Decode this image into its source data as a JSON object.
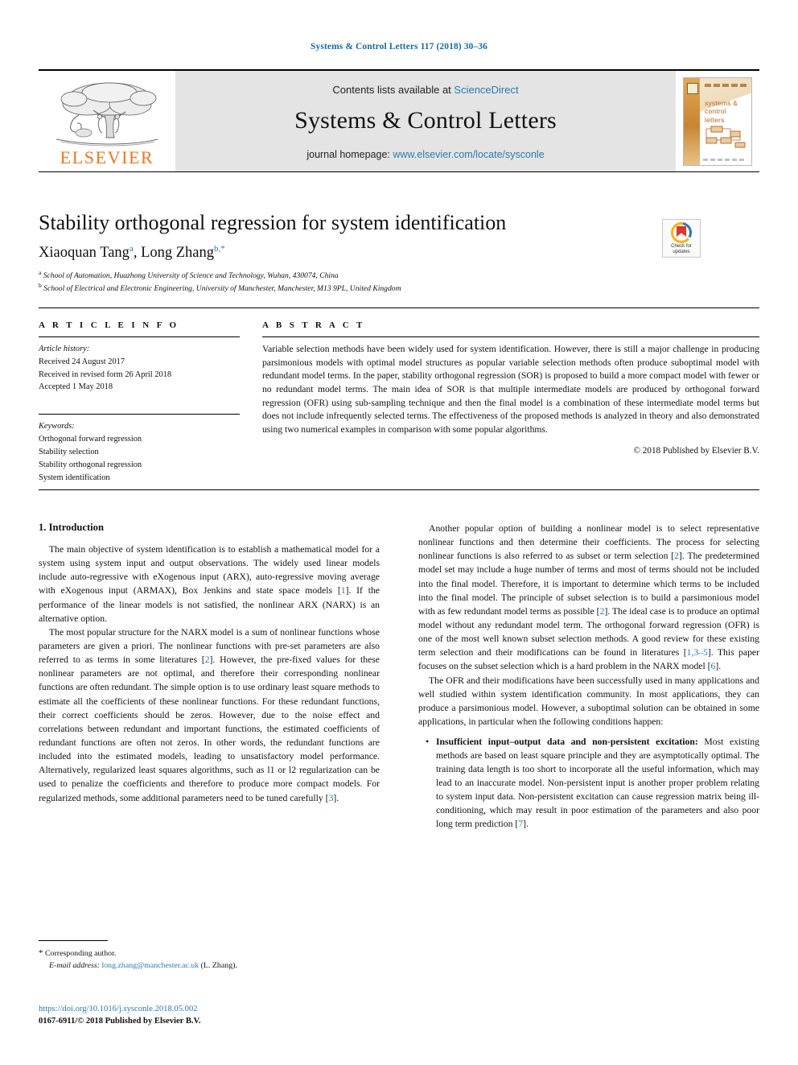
{
  "running_head": "Systems & Control Letters 117 (2018) 30–36",
  "masthead": {
    "contents_prefix": "Contents lists available at ",
    "sciencedirect": "ScienceDirect",
    "journal_title": "Systems & Control Letters",
    "homepage_prefix": "journal homepage: ",
    "homepage_url": "www.elsevier.com/locate/sysconle",
    "publisher_wordmark": "ELSEVIER",
    "publisher_color": "#E87722",
    "link_color": "#2a7ab0",
    "cover_title": "systems & control letters"
  },
  "article": {
    "title": "Stability orthogonal regression for system identification",
    "authors": "Xiaoquan Tang a, Long Zhang b,*",
    "author1_name": "Xiaoquan Tang",
    "author1_marker": "a",
    "author2_name": "Long Zhang",
    "author2_marker": "b,*",
    "affiliations": [
      {
        "marker": "a",
        "text": "School of Automation, Huazhong University of Science and Technology, Wuhan, 430074, China"
      },
      {
        "marker": "b",
        "text": "School of Electrical and Electronic Engineering, University of Manchester, Manchester, M13 9PL, United Kingdom"
      }
    ],
    "crossmark_line1": "Check for",
    "crossmark_line2": "updates"
  },
  "article_info": {
    "heading": "A R T I C L E   I N F O",
    "history_label": "Article history:",
    "history": [
      "Received 24 August 2017",
      "Received in revised form 26 April 2018",
      "Accepted 1 May 2018"
    ],
    "keywords_label": "Keywords:",
    "keywords": [
      "Orthogonal forward regression",
      "Stability selection",
      "Stability orthogonal regression",
      "System identification"
    ]
  },
  "abstract": {
    "heading": "A B S T R A C T",
    "text": "Variable selection methods have been widely used for system identification. However, there is still a major challenge in producing parsimonious models with optimal model structures as popular variable selection methods often produce suboptimal model with redundant model terms. In the paper, stability orthogonal regression (SOR) is proposed to build a more compact model with fewer or no redundant model terms. The main idea of SOR is that multiple intermediate models are produced by orthogonal forward regression (OFR) using sub-sampling technique and then the final model is a combination of these intermediate model terms but does not include infrequently selected terms. The effectiveness of the proposed methods is analyzed in theory and also demonstrated using two numerical examples in comparison with some popular algorithms.",
    "copyright": "© 2018 Published by Elsevier B.V."
  },
  "body": {
    "section_number_title": "1. Introduction",
    "left_paragraphs": [
      "The main objective of system identification is to establish a mathematical model for a system using system input and output observations. The widely used linear models include auto-regressive with eXogenous input (ARX), auto-regressive moving average with eXogenous input (ARMAX), Box Jenkins and state space models [1]. If the performance of the linear models is not satisfied, the nonlinear ARX (NARX) is an alternative option.",
      "The most popular structure for the NARX model is a sum of nonlinear functions whose parameters are given a priori. The nonlinear functions with pre-set parameters are also referred to as terms in some literatures [2]. However, the pre-fixed values for these nonlinear parameters are not optimal, and therefore their corresponding nonlinear functions are often redundant. The simple option is to use ordinary least square methods to estimate all the coefficients of these nonlinear functions. For these redundant functions, their correct coefficients should be zeros. However, due to the noise effect and correlations between redundant and important functions, the estimated coefficients of redundant functions are often not zeros. In other words, the redundant functions are included into the estimated models, leading to unsatisfactory model performance. Alternatively, regularized least squares algorithms, such as l1 or l2 regularization can be used to penalize the coefficients and therefore to produce more compact models. For regularized methods, some additional parameters need to be tuned carefully [3]."
    ],
    "right_paragraphs": [
      "Another popular option of building a nonlinear model is to select representative nonlinear functions and then determine their coefficients. The process for selecting nonlinear functions is also referred to as subset or term selection [2]. The predetermined model set may include a huge number of terms and most of terms should not be included into the final model. Therefore, it is important to determine which terms to be included into the final model. The principle of subset selection is to build a parsimonious model with as few redundant model terms as possible [2]. The ideal case is to produce an optimal model without any redundant model term. The orthogonal forward regression (OFR) is one of the most well known subset selection methods. A good review for these existing term selection and their modifications can be found in literatures [1,3–5]. This paper focuses on the subset selection which is a hard problem in the NARX model [6].",
      "The OFR and their modifications have been successfully used in many applications and well studied within system identification community. In most applications, they can produce a parsimonious model. However, a suboptimal solution can be obtained in some applications, in particular when the following conditions happen:"
    ],
    "bullets": [
      {
        "lead": "Insufficient input–output data and non-persistent excitation:",
        "text": " Most existing methods are based on least square principle and they are asymptotically optimal. The training data length is too short to incorporate all the useful information, which may lead to an inaccurate model. Non-persistent input is another proper problem relating to system input data. Non-persistent excitation can cause regression matrix being ill-conditioning, which may result in poor estimation of the parameters and also poor long term prediction [7]."
      }
    ],
    "citation_color": "#2a7ab0"
  },
  "footer": {
    "corresponding_marker": "*",
    "corresponding_label": "Corresponding author.",
    "email_label": "E-mail address:",
    "email": "long.zhang@manchester.ac.uk",
    "email_owner": "(L. Zhang).",
    "doi": "https://doi.org/10.1016/j.sysconle.2018.05.002",
    "issn_line": "0167-6911/© 2018 Published by Elsevier B.V."
  }
}
